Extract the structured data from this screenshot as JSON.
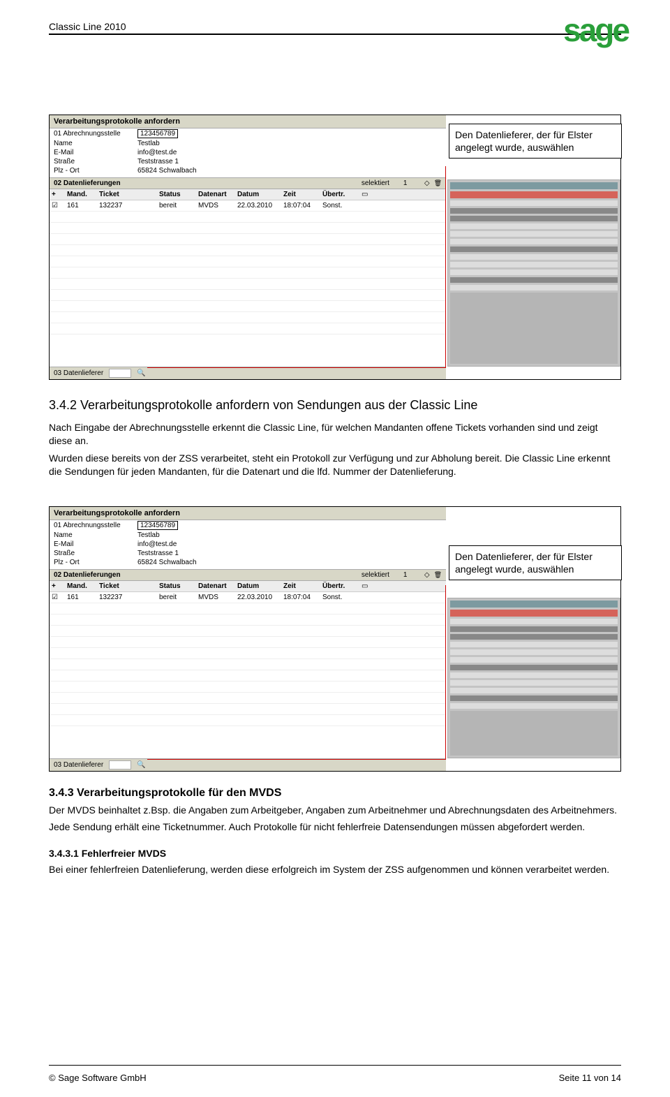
{
  "header": {
    "product_line": "Classic Line 2010",
    "logo_text": "sage"
  },
  "callout": {
    "text": "Den Datenlieferer, der für Elster angelegt wurde, auswählen"
  },
  "form": {
    "title": "Verarbeitungsprotokolle anfordern",
    "fields": {
      "abrech": {
        "label": "01 Abrechnungsstelle",
        "value": "123456789"
      },
      "name": {
        "label": "Name",
        "value": "Testlab"
      },
      "email": {
        "label": "E-Mail",
        "value": "info@test.de"
      },
      "strasse": {
        "label": "Straße",
        "value": "Teststrasse 1"
      },
      "plzort": {
        "label": "Plz - Ort",
        "value": "65824   Schwalbach"
      }
    },
    "section2": {
      "label": "02 Datenlieferungen",
      "selektiert": "selektiert",
      "count": "1"
    },
    "columns": {
      "mand": "Mand.",
      "ticket": "Ticket",
      "status": "Status",
      "datenart": "Datenart",
      "datum": "Datum",
      "zeit": "Zeit",
      "uebertr": "Übertr."
    },
    "row": {
      "mand": "161",
      "ticket": "132237",
      "status": "bereit",
      "datenart": "MVDS",
      "datum": "22.03.2010",
      "zeit": "18:07:04",
      "uebertr": "Sonst."
    },
    "section3": {
      "label": "03 Datenlieferer"
    }
  },
  "side_panel_items": {
    "lbl1": "Datenlieferer (ELSTER)",
    "lbl2": "Proxyeinstellungen HTTPS",
    "lbl3": "Allgemeine Einstellungen",
    "lbl4": "Proxy Authentifizierung",
    "lbl5": "Einstellungen für die Lohnsteuerbescheinigung (LSt)"
  },
  "section_342": {
    "heading": "3.4.2   Verarbeitungsprotokolle anfordern von Sendungen aus der Classic Line",
    "p1": "Nach Eingabe der Abrechnungsstelle erkennt die Classic Line, für welchen Mandanten offene Tickets vorhanden sind und zeigt diese an.",
    "p2": "Wurden diese bereits von der ZSS verarbeitet, steht ein Protokoll zur Verfügung und zur Abholung bereit. Die Classic Line erkennt die Sendungen für jeden Mandanten, für die Datenart und die lfd. Nummer der Datenlieferung."
  },
  "section_343": {
    "heading": "3.4.3   Verarbeitungsprotokolle für den MVDS",
    "p1": "Der MVDS beinhaltet z.Bsp. die Angaben zum Arbeitgeber, Angaben zum Arbeitnehmer und Abrechnungsdaten des Arbeitnehmers.",
    "p2": "Jede Sendung erhält eine Ticketnummer. Auch  Protokolle für nicht fehlerfreie Datensendungen müssen abgefordert werden."
  },
  "section_3431": {
    "heading": "3.4.3.1  Fehlerfreier MVDS",
    "p1": "Bei einer fehlerfreien Datenlieferung, werden diese erfolgreich im System der ZSS aufgenommen und können verarbeitet werden."
  },
  "footer": {
    "left": "© Sage Software GmbH",
    "right": "Seite 11 von 14"
  }
}
